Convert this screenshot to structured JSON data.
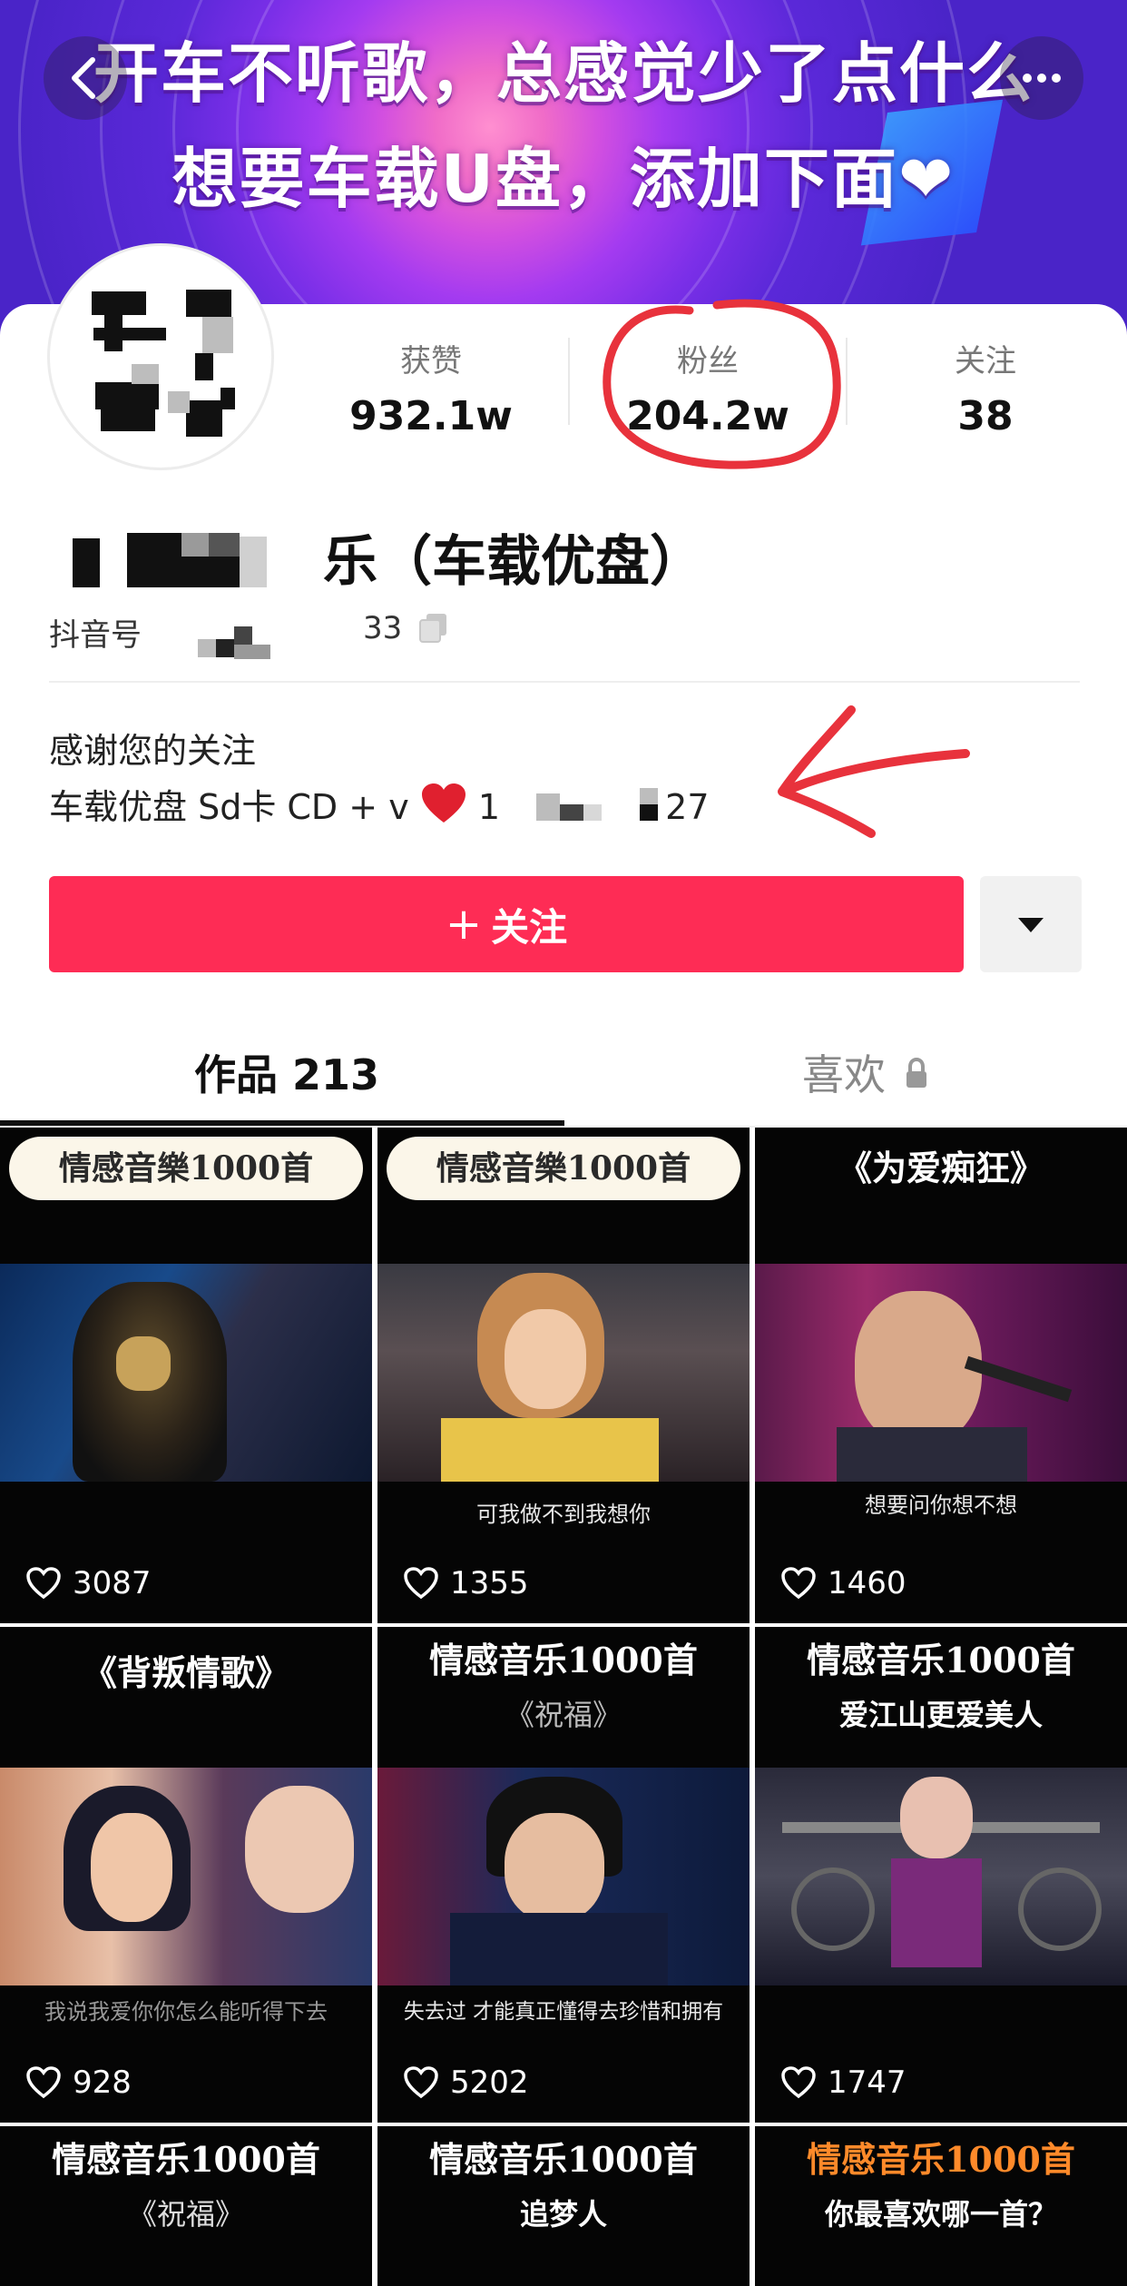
{
  "banner": {
    "line1": "开车不听歌，总感觉少了点什么",
    "line2": "想要车载U盘，添加下面❤"
  },
  "profile": {
    "stats": [
      {
        "label": "获赞",
        "value": "932.1w"
      },
      {
        "label": "粉丝",
        "value": "204.2w"
      },
      {
        "label": "关注",
        "value": "38"
      }
    ],
    "nickname_suffix": "乐（车载优盘）",
    "douyin_id_label": "抖音号",
    "douyin_id_tail": "33",
    "bio_line1": "感谢您的关注",
    "bio_line2_prefix": "车载优盘  Sd卡 CD + v",
    "bio_line2_num": "1",
    "bio_line2_tail": "27",
    "follow_label": "关注",
    "follow_plus": "+"
  },
  "tabs": {
    "works": "作品 213",
    "likes": "喜欢"
  },
  "videos": [
    {
      "pill": "情感音樂1000首",
      "likes": "3087"
    },
    {
      "pill": "情感音樂1000首",
      "caption": "可我做不到我想你",
      "likes": "1355"
    },
    {
      "title": "《为爱痴狂》",
      "caption": "想要问你想不想",
      "likes": "1460"
    },
    {
      "title": "《背叛情歌》",
      "caption": "我说我爱你你怎么能听得下去",
      "likes": "928"
    },
    {
      "title": "情感音乐1000首",
      "subtitle": "《祝福》",
      "caption": "失去过 才能真正懂得去珍惜和拥有",
      "likes": "5202"
    },
    {
      "title": "情感音乐1000首",
      "subtitle": "爱江山更爱美人",
      "likes": "1747"
    },
    {
      "title": "情感音乐1000首",
      "subtitle": "《祝福》"
    },
    {
      "title": "情感音乐1000首",
      "subtitle": "追梦人"
    },
    {
      "title": "情感音乐1000首",
      "subtitle": "你最喜欢哪一首？"
    }
  ],
  "colors": {
    "follow_button": "#fe2c55",
    "annotation_red": "#e8323c",
    "banner_purple": "#7b2fe8"
  },
  "icons": [
    "back-icon",
    "more-icon",
    "copy-icon",
    "heart-icon",
    "lock-icon",
    "dropdown-icon"
  ]
}
